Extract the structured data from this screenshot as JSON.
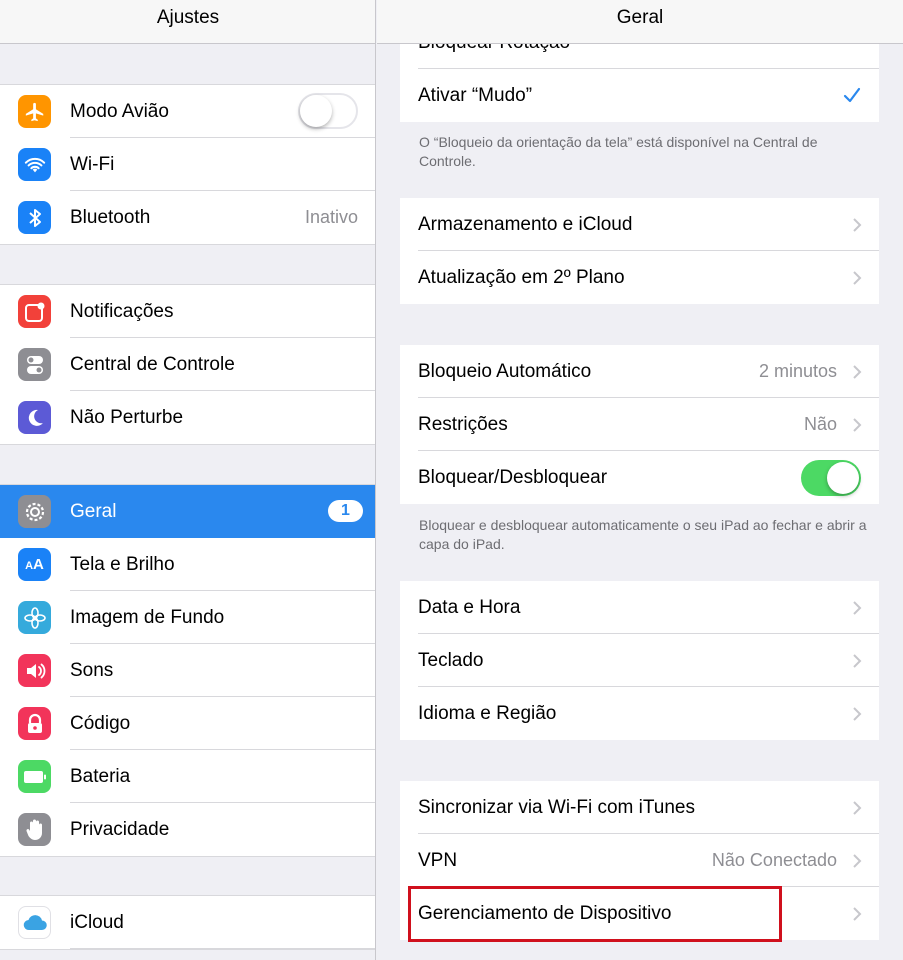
{
  "left": {
    "title": "Ajustes",
    "groups": [
      [
        {
          "label": "Modo Avião",
          "icon": "airplane-icon",
          "color": "#ff9500",
          "toggle": "off"
        },
        {
          "label": "Wi-Fi",
          "icon": "wifi-icon",
          "color": "#1a82f7"
        },
        {
          "label": "Bluetooth",
          "icon": "bluetooth-icon",
          "color": "#1a82f7",
          "value": "Inativo"
        }
      ],
      [
        {
          "label": "Notificações",
          "icon": "notifications-icon",
          "color": "#f2413a"
        },
        {
          "label": "Central de Controle",
          "icon": "control-center-icon",
          "color": "#8e8e93"
        },
        {
          "label": "Não Perturbe",
          "icon": "moon-icon",
          "color": "#5c5ad6"
        }
      ],
      [
        {
          "label": "Geral",
          "icon": "gear-icon",
          "color": "#8e8e93",
          "badge": "1",
          "selected": true
        },
        {
          "label": "Tela e Brilho",
          "icon": "display-brightness-icon",
          "color": "#1a82f7"
        },
        {
          "label": "Imagem de Fundo",
          "icon": "wallpaper-icon",
          "color": "#35aadc"
        },
        {
          "label": "Sons",
          "icon": "speaker-icon",
          "color": "#f2345a"
        },
        {
          "label": "Código",
          "icon": "lock-icon",
          "color": "#f2345a"
        },
        {
          "label": "Bateria",
          "icon": "battery-icon",
          "color": "#4cd964"
        },
        {
          "label": "Privacidade",
          "icon": "hand-icon",
          "color": "#8e8e93"
        }
      ],
      [
        {
          "label": "iCloud",
          "icon": "cloud-icon",
          "color": "#ffffff"
        }
      ]
    ]
  },
  "right": {
    "title": "Geral",
    "partial_row": "Bloquear Rotação",
    "mute_row": "Ativar “Mudo”",
    "note1": "O “Bloqueio da orientação da tela” está disponível na Central de Controle.",
    "group2": [
      "Armazenamento e iCloud",
      "Atualização em 2º Plano"
    ],
    "group3": {
      "auto_lock": {
        "label": "Bloqueio Automático",
        "value": "2 minutos"
      },
      "restrictions": {
        "label": "Restrições",
        "value": "Não"
      },
      "lock_unlock": {
        "label": "Bloquear/Desbloquear",
        "toggle": "on"
      }
    },
    "note2": "Bloquear e desbloquear automaticamente o seu iPad ao fechar e abrir a capa do iPad.",
    "group4": [
      "Data e Hora",
      "Teclado",
      "Idioma e Região"
    ],
    "group5": {
      "sync": {
        "label": "Sincronizar via Wi-Fi com iTunes"
      },
      "vpn": {
        "label": "VPN",
        "value": "Não Conectado"
      },
      "device_mgmt": {
        "label": "Gerenciamento de Dispositivo"
      }
    }
  },
  "colors": {
    "accent": "#2a88ee",
    "highlight": "#d0101d",
    "toggle_on": "#4cd964"
  }
}
